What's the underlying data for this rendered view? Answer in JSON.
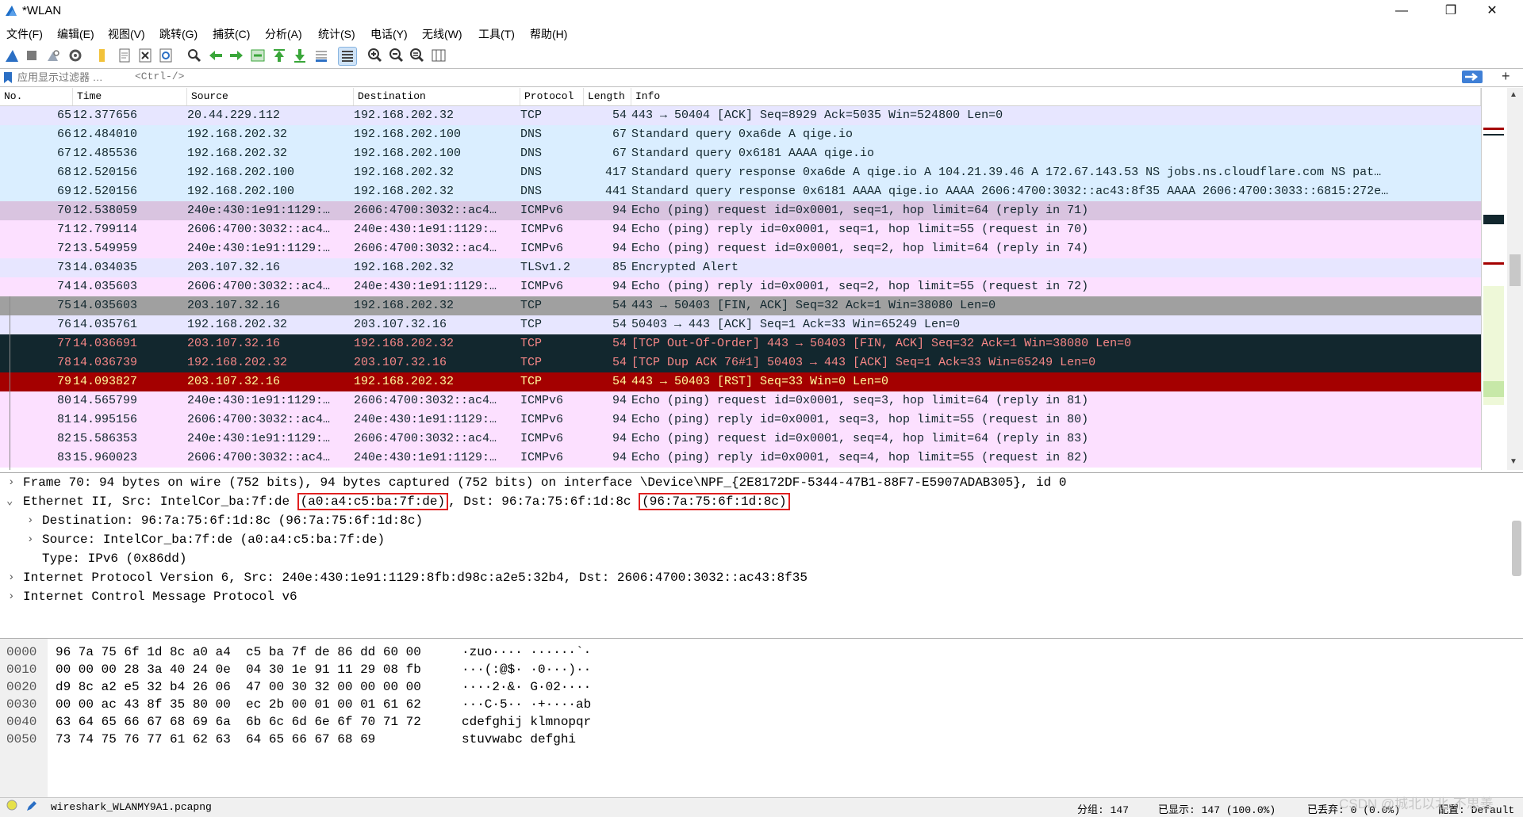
{
  "window": {
    "title": "*WLAN",
    "min": "—",
    "max": "❐",
    "close": "✕"
  },
  "menu": [
    "文件(F)",
    "编辑(E)",
    "视图(V)",
    "跳转(G)",
    "捕获(C)",
    "分析(A)",
    "统计(S)",
    "电话(Y)",
    "无线(W)",
    "工具(T)",
    "帮助(H)"
  ],
  "toolbar_icons": [
    "shark-fin-start-icon",
    "stop-icon",
    "restart-icon",
    "options-gear-icon",
    "open-folder-icon",
    "file-set-icon",
    "close-file-icon",
    "reload-icon",
    "find-icon",
    "go-back-icon",
    "go-forward-icon",
    "go-to-packet-icon",
    "first-packet-icon",
    "last-packet-icon",
    "auto-scroll-icon",
    "colorize-icon",
    "zoom-in-icon",
    "zoom-out-icon",
    "zoom-normal-icon",
    "resize-columns-icon"
  ],
  "filter": {
    "placeholder": "应用显示过滤器 …",
    "hint": "<Ctrl-/>",
    "add": "+"
  },
  "columns": [
    "No.",
    "Time",
    "Source",
    "Destination",
    "Protocol",
    "Length",
    "Info"
  ],
  "packets": [
    {
      "no": "65",
      "time": "12.377656",
      "src": "20.44.229.112",
      "dst": "192.168.202.32",
      "proto": "TCP",
      "len": "54",
      "info": "443 → 50404 [ACK] Seq=8929 Ack=5035 Win=524800 Len=0",
      "bg": "#e7e6ff",
      "fg": "#12272e"
    },
    {
      "no": "66",
      "time": "12.484010",
      "src": "192.168.202.32",
      "dst": "192.168.202.100",
      "proto": "DNS",
      "len": "67",
      "info": "Standard query 0xa6de A qige.io",
      "bg": "#daeeff",
      "fg": "#12272e"
    },
    {
      "no": "67",
      "time": "12.485536",
      "src": "192.168.202.32",
      "dst": "192.168.202.100",
      "proto": "DNS",
      "len": "67",
      "info": "Standard query 0x6181 AAAA qige.io",
      "bg": "#daeeff",
      "fg": "#12272e"
    },
    {
      "no": "68",
      "time": "12.520156",
      "src": "192.168.202.100",
      "dst": "192.168.202.32",
      "proto": "DNS",
      "len": "417",
      "info": "Standard query response 0xa6de A qige.io A 104.21.39.46 A 172.67.143.53 NS jobs.ns.cloudflare.com NS pat…",
      "bg": "#daeeff",
      "fg": "#12272e"
    },
    {
      "no": "69",
      "time": "12.520156",
      "src": "192.168.202.100",
      "dst": "192.168.202.32",
      "proto": "DNS",
      "len": "441",
      "info": "Standard query response 0x6181 AAAA qige.io AAAA 2606:4700:3032::ac43:8f35 AAAA 2606:4700:3033::6815:272e…",
      "bg": "#daeeff",
      "fg": "#12272e"
    },
    {
      "no": "70",
      "time": "12.538059",
      "src": "240e:430:1e91:1129:…",
      "dst": "2606:4700:3032::ac4…",
      "proto": "ICMPv6",
      "len": "94",
      "info": "Echo (ping) request id=0x0001, seq=1, hop limit=64 (reply in 71)",
      "bg": "#d9c4e0",
      "fg": "#12272e"
    },
    {
      "no": "71",
      "time": "12.799114",
      "src": "2606:4700:3032::ac4…",
      "dst": "240e:430:1e91:1129:…",
      "proto": "ICMPv6",
      "len": "94",
      "info": "Echo (ping) reply id=0x0001, seq=1, hop limit=55 (request in 70)",
      "bg": "#fce0ff",
      "fg": "#12272e"
    },
    {
      "no": "72",
      "time": "13.549959",
      "src": "240e:430:1e91:1129:…",
      "dst": "2606:4700:3032::ac4…",
      "proto": "ICMPv6",
      "len": "94",
      "info": "Echo (ping) request id=0x0001, seq=2, hop limit=64 (reply in 74)",
      "bg": "#fce0ff",
      "fg": "#12272e"
    },
    {
      "no": "73",
      "time": "14.034035",
      "src": "203.107.32.16",
      "dst": "192.168.202.32",
      "proto": "TLSv1.2",
      "len": "85",
      "info": "Encrypted Alert",
      "bg": "#e7e6ff",
      "fg": "#12272e"
    },
    {
      "no": "74",
      "time": "14.035603",
      "src": "2606:4700:3032::ac4…",
      "dst": "240e:430:1e91:1129:…",
      "proto": "ICMPv6",
      "len": "94",
      "info": "Echo (ping) reply id=0x0001, seq=2, hop limit=55 (request in 72)",
      "bg": "#fce0ff",
      "fg": "#12272e"
    },
    {
      "no": "75",
      "time": "14.035603",
      "src": "203.107.32.16",
      "dst": "192.168.202.32",
      "proto": "TCP",
      "len": "54",
      "info": "443 → 50403 [FIN, ACK] Seq=32 Ack=1 Win=38080 Len=0",
      "bg": "#a0a0a0",
      "fg": "#12272e"
    },
    {
      "no": "76",
      "time": "14.035761",
      "src": "192.168.202.32",
      "dst": "203.107.32.16",
      "proto": "TCP",
      "len": "54",
      "info": "50403 → 443 [ACK] Seq=1 Ack=33 Win=65249 Len=0",
      "bg": "#e7e6ff",
      "fg": "#12272e"
    },
    {
      "no": "77",
      "time": "14.036691",
      "src": "203.107.32.16",
      "dst": "192.168.202.32",
      "proto": "TCP",
      "len": "54",
      "info": "[TCP Out-Of-Order] 443 → 50403 [FIN, ACK] Seq=32 Ack=1 Win=38080 Len=0",
      "bg": "#12272e",
      "fg": "#f78787"
    },
    {
      "no": "78",
      "time": "14.036739",
      "src": "192.168.202.32",
      "dst": "203.107.32.16",
      "proto": "TCP",
      "len": "54",
      "info": "[TCP Dup ACK 76#1] 50403 → 443 [ACK] Seq=1 Ack=33 Win=65249 Len=0",
      "bg": "#12272e",
      "fg": "#f78787"
    },
    {
      "no": "79",
      "time": "14.093827",
      "src": "203.107.32.16",
      "dst": "192.168.202.32",
      "proto": "TCP",
      "len": "54",
      "info": "443 → 50403 [RST] Seq=33 Win=0 Len=0",
      "bg": "#a40000",
      "fg": "#fffc9c"
    },
    {
      "no": "80",
      "time": "14.565799",
      "src": "240e:430:1e91:1129:…",
      "dst": "2606:4700:3032::ac4…",
      "proto": "ICMPv6",
      "len": "94",
      "info": "Echo (ping) request id=0x0001, seq=3, hop limit=64 (reply in 81)",
      "bg": "#fce0ff",
      "fg": "#12272e"
    },
    {
      "no": "81",
      "time": "14.995156",
      "src": "2606:4700:3032::ac4…",
      "dst": "240e:430:1e91:1129:…",
      "proto": "ICMPv6",
      "len": "94",
      "info": "Echo (ping) reply id=0x0001, seq=3, hop limit=55 (request in 80)",
      "bg": "#fce0ff",
      "fg": "#12272e"
    },
    {
      "no": "82",
      "time": "15.586353",
      "src": "240e:430:1e91:1129:…",
      "dst": "2606:4700:3032::ac4…",
      "proto": "ICMPv6",
      "len": "94",
      "info": "Echo (ping) request id=0x0001, seq=4, hop limit=64 (reply in 83)",
      "bg": "#fce0ff",
      "fg": "#12272e"
    },
    {
      "no": "83",
      "time": "15.960023",
      "src": "2606:4700:3032::ac4…",
      "dst": "240e:430:1e91:1129:…",
      "proto": "ICMPv6",
      "len": "94",
      "info": "Echo (ping) reply id=0x0001, seq=4, hop limit=55 (request in 82)",
      "bg": "#fce0ff",
      "fg": "#12272e"
    }
  ],
  "details": {
    "frame": "Frame 70: 94 bytes on wire (752 bits), 94 bytes captured (752 bits) on interface \\Device\\NPF_{2E8172DF-5344-47B1-88F7-E5907ADAB305}, id 0",
    "eth_prefix": "Ethernet II, Src: IntelCor_ba:7f:de ",
    "eth_src_mac": "(a0:a4:c5:ba:7f:de)",
    "eth_mid": ", Dst: 96:7a:75:6f:1d:8c ",
    "eth_dst_mac": "(96:7a:75:6f:1d:8c)",
    "destination": "Destination: 96:7a:75:6f:1d:8c (96:7a:75:6f:1d:8c)",
    "source": "Source: IntelCor_ba:7f:de (a0:a4:c5:ba:7f:de)",
    "type": "Type: IPv6 (0x86dd)",
    "ipv6": "Internet Protocol Version 6, Src: 240e:430:1e91:1129:8fb:d98c:a2e5:32b4, Dst: 2606:4700:3032::ac43:8f35",
    "icmpv6": "Internet Control Message Protocol v6"
  },
  "hex": [
    {
      "off": "0000",
      "bytes": "96 7a 75 6f 1d 8c a0 a4  c5 ba 7f de 86 dd 60 00",
      "ascii": "·zuo···· ······`·"
    },
    {
      "off": "0010",
      "bytes": "00 00 00 28 3a 40 24 0e  04 30 1e 91 11 29 08 fb",
      "ascii": "···(:@$· ·0···)··"
    },
    {
      "off": "0020",
      "bytes": "d9 8c a2 e5 32 b4 26 06  47 00 30 32 00 00 00 00",
      "ascii": "····2·&· G·02····"
    },
    {
      "off": "0030",
      "bytes": "00 00 ac 43 8f 35 80 00  ec 2b 00 01 00 01 61 62",
      "ascii": "···C·5·· ·+····ab"
    },
    {
      "off": "0040",
      "bytes": "63 64 65 66 67 68 69 6a  6b 6c 6d 6e 6f 70 71 72",
      "ascii": "cdefghij klmnopqr"
    },
    {
      "off": "0050",
      "bytes": "73 74 75 76 77 61 62 63  64 65 66 67 68 69",
      "ascii": "stuvwabc defghi"
    }
  ],
  "status": {
    "file": "wireshark_WLANMY9A1.pcapng",
    "packets": "分组: 147",
    "displayed": "已显示: 147 (100.0%)",
    "dropped": "已丢弃: 0 (0.0%)",
    "profile": "配置: Default"
  },
  "watermark": "CSDN @城北以北·不思善"
}
